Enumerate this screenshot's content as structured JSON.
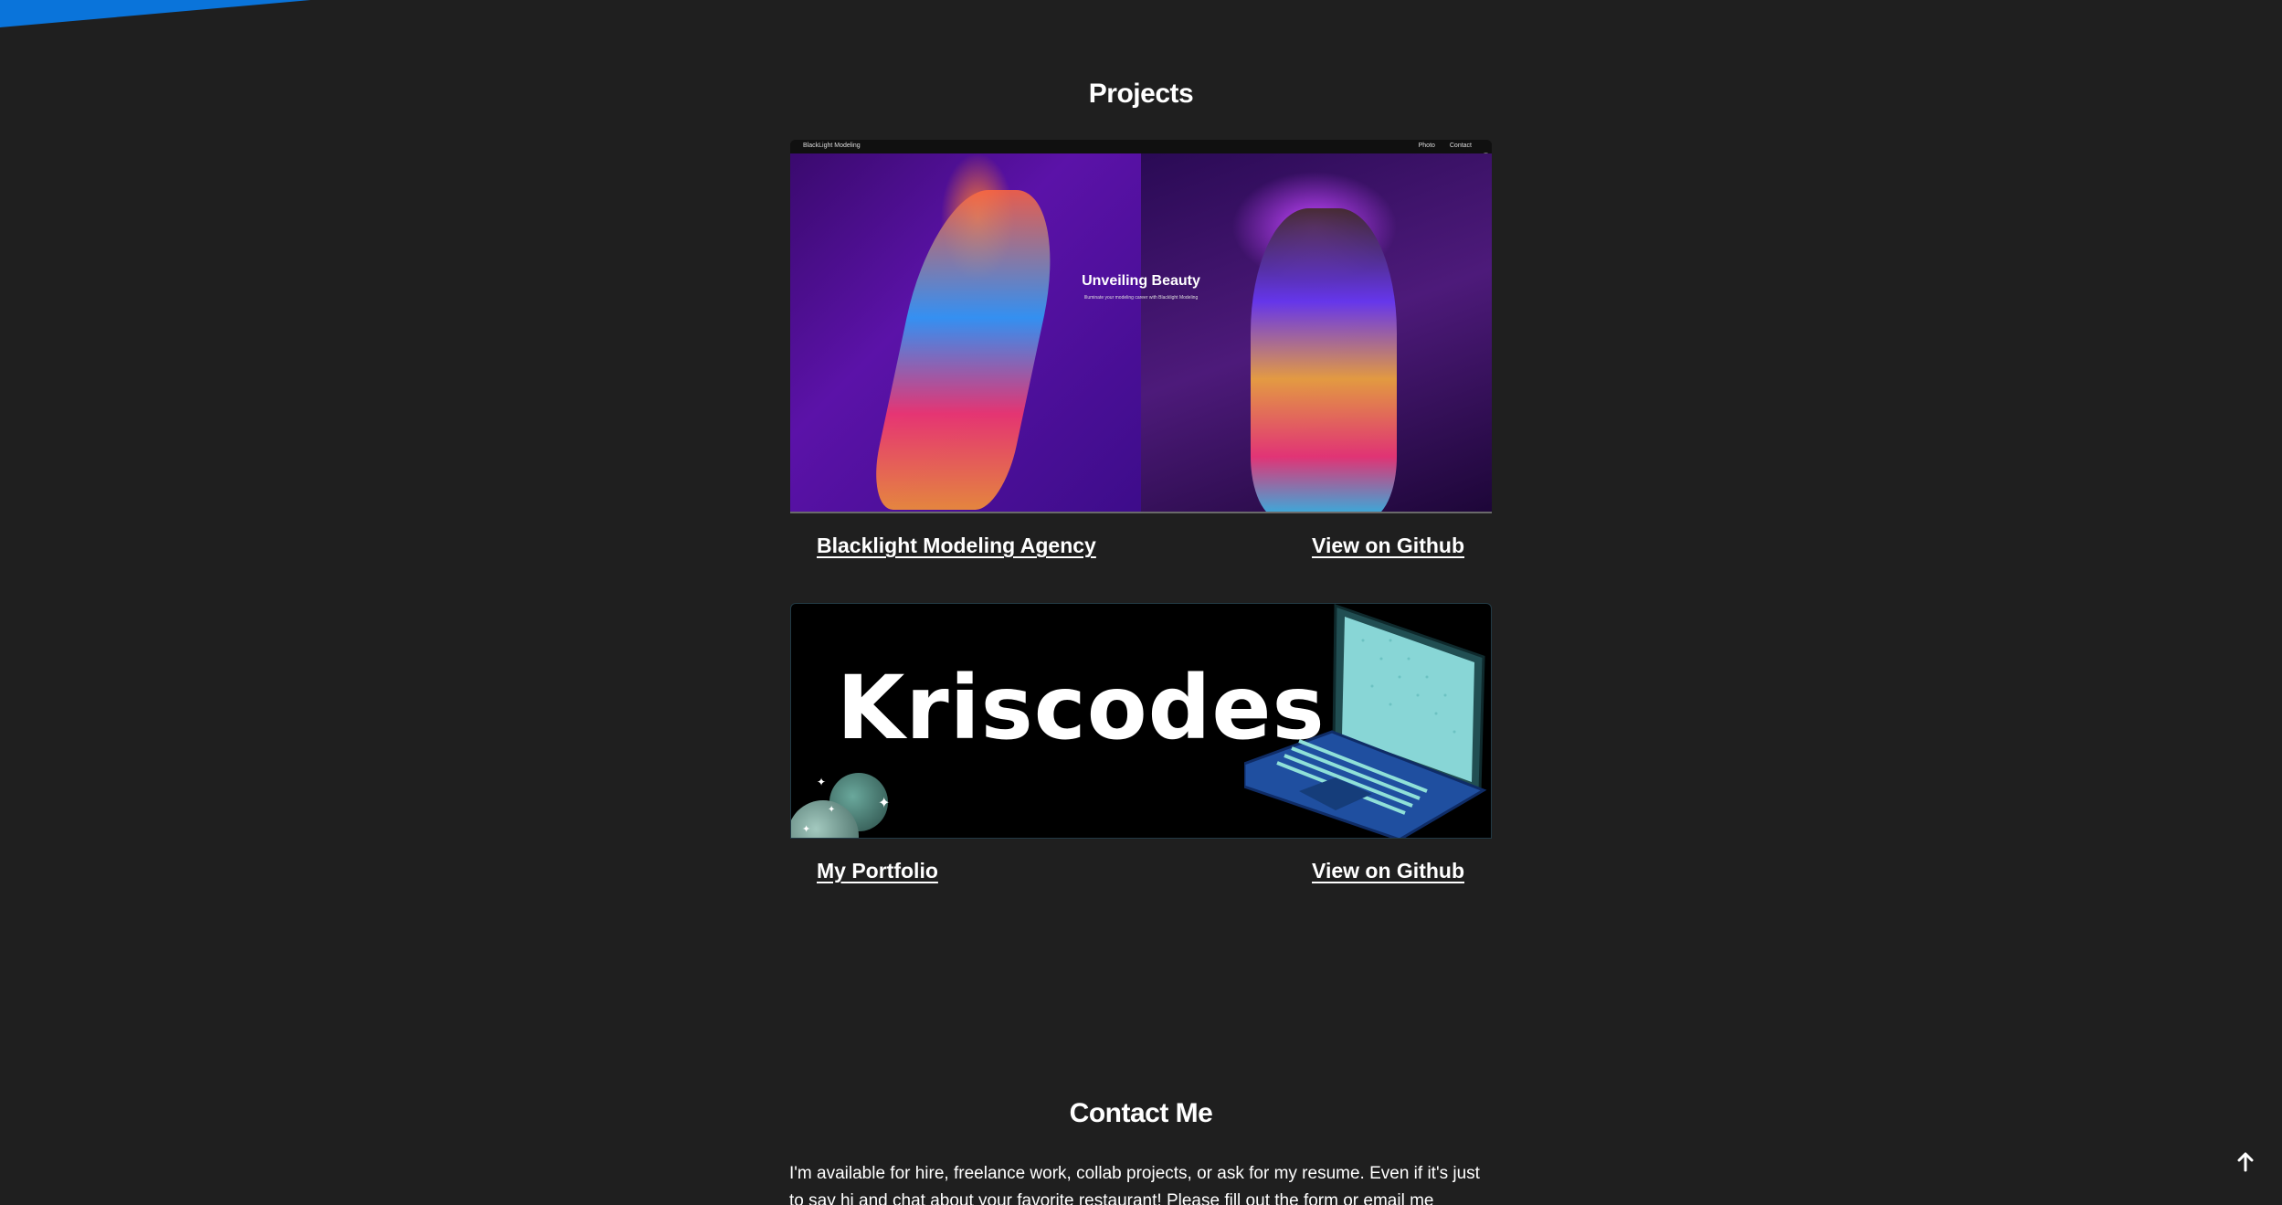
{
  "colors": {
    "background": "#1f1f1f",
    "accent": "#0a74da",
    "text": "#ffffff"
  },
  "projects_section": {
    "title": "Projects",
    "projects": [
      {
        "name": "Blacklight Modeling Agency",
        "github_label": "View on Github",
        "preview": {
          "brand": "BlackLight Modeling",
          "nav_links": [
            "Photo",
            "Contact"
          ],
          "headline": "Unveiling Beauty",
          "subheadline": "Illuminate your modeling career with Blacklight Modeling"
        }
      },
      {
        "name": "My Portfolio",
        "github_label": "View on Github",
        "preview": {
          "logo_text": "Kriscodes_",
          "image_icon": "laptop-icon"
        }
      }
    ]
  },
  "contact_section": {
    "title": "Contact Me",
    "text": "I'm available for hire, freelance work, collab projects, or ask for my resume. Even if it's just to say hi and chat about your favorite restaurant! Please fill out the form or email me directly."
  },
  "scroll_top": {
    "icon": "arrow-up-icon"
  }
}
